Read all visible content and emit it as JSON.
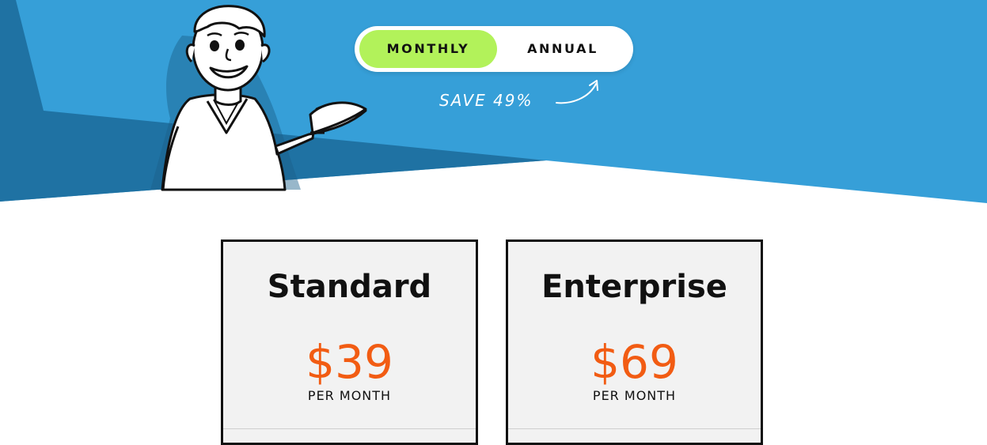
{
  "colors": {
    "hero_blue": "#369fd8",
    "hero_dark_blue": "#1f72a3",
    "toggle_active": "#b2f25a",
    "price_orange": "#f25c13",
    "card_bg": "#f2f2f2"
  },
  "billing_toggle": {
    "monthly_label": "MONTHLY",
    "annual_label": "ANNUAL",
    "selected": "MONTHLY"
  },
  "save_note": "SAVE 49%",
  "plans": [
    {
      "name": "Standard",
      "price": "$39",
      "period": "PER MONTH"
    },
    {
      "name": "Enterprise",
      "price": "$69",
      "period": "PER MONTH"
    }
  ]
}
